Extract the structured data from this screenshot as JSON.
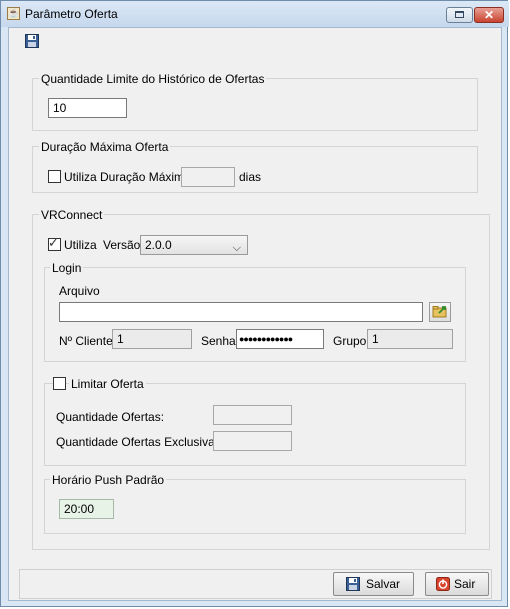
{
  "window": {
    "title": "Parâmetro Oferta",
    "close_glyph": "✕",
    "app_icon": "java-cup-icon"
  },
  "historico": {
    "title": "Quantidade Limite do Histórico de Ofertas",
    "value": "10"
  },
  "duracao": {
    "title": "Duração Máxima Oferta",
    "checkbox_label": "Utiliza Duração Máxima",
    "checked": false,
    "value": "",
    "unit": "dias"
  },
  "vrconnect": {
    "title": "VRConnect",
    "utiliza_label": "Utiliza",
    "utiliza_checked": true,
    "versao_label": "Versão",
    "versao_value": "2.0.0",
    "login": {
      "title": "Login",
      "arquivo_label": "Arquivo",
      "arquivo_value": "",
      "cliente_label": "Nº Cliente",
      "cliente_value": "1",
      "senha_label": "Senha",
      "senha_value": "●●●●●●●●●●●●",
      "grupo_label": "Grupo",
      "grupo_value": "1"
    },
    "limitar": {
      "title": "Limitar Oferta",
      "checked": false,
      "qtd_label": "Quantidade Ofertas:",
      "qtd_value": "",
      "qtd_excl_label": "Quantidade Ofertas Exclusivas:",
      "qtd_excl_value": ""
    },
    "push": {
      "title": "Horário Push Padrão",
      "value": "20:00"
    }
  },
  "footer": {
    "save_label": "Salvar",
    "exit_label": "Sair"
  },
  "colors": {
    "title_bar": "#c6d8ed",
    "close_button": "#c8432f",
    "field_green": "#e6f3e6"
  }
}
